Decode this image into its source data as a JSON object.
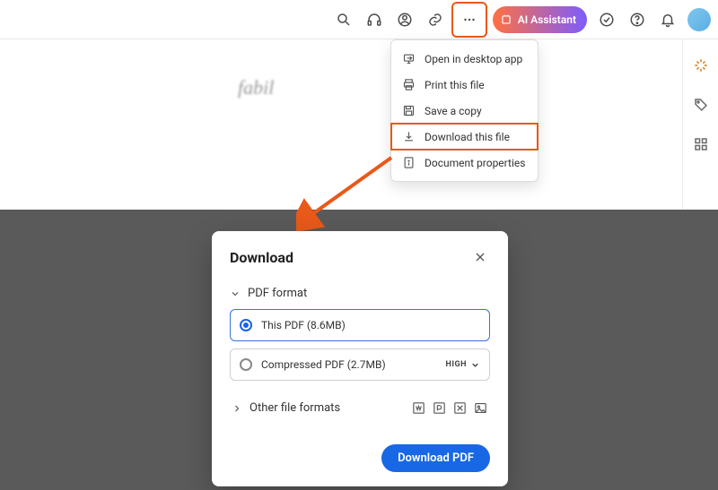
{
  "toolbar": {
    "ai_assistant_label": "AI Assistant"
  },
  "dropdown": {
    "open_desktop": "Open in desktop app",
    "print": "Print this file",
    "save_copy": "Save a copy",
    "download": "Download this file",
    "properties": "Document properties"
  },
  "dialog": {
    "title": "Download",
    "section_pdf": "PDF format",
    "option_this_pdf": "This PDF (8.6MB)",
    "option_compressed": "Compressed PDF (2.7MB)",
    "quality_label": "HIGH",
    "section_other": "Other file formats",
    "download_button": "Download PDF"
  }
}
